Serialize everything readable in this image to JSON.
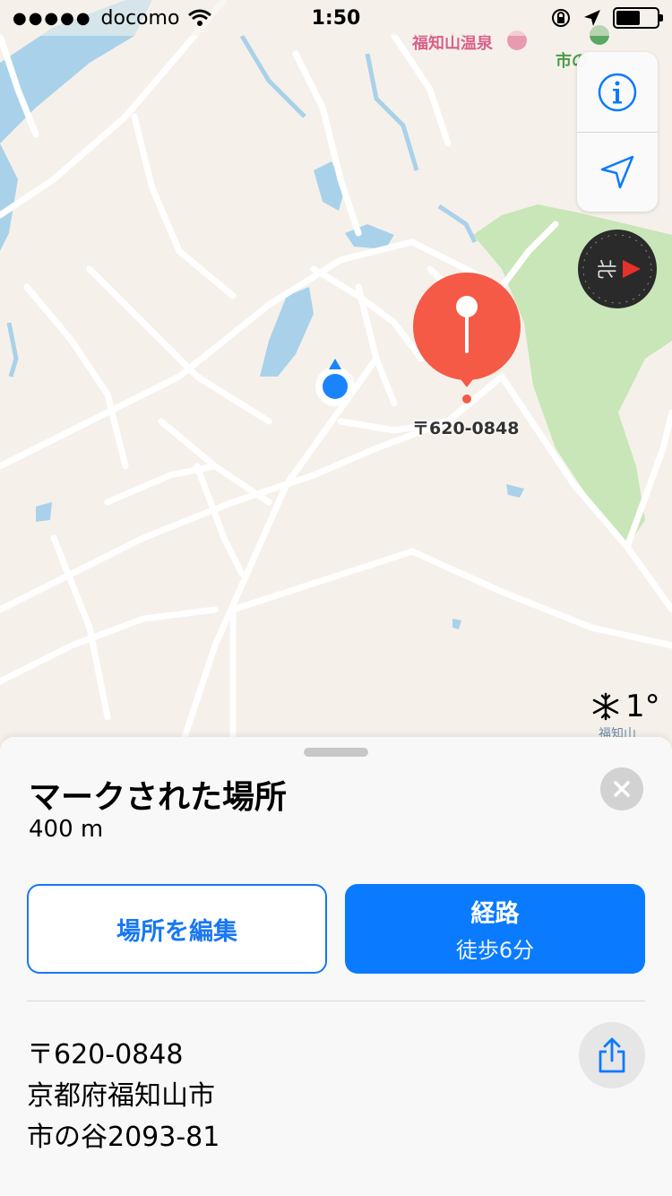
{
  "status_bar": {
    "carrier": "docomo",
    "time": "1:50",
    "battery_level": 0.6
  },
  "map": {
    "labels": {
      "onsen": "福知山温泉",
      "station": "市の",
      "bottom_right": "福知山",
      "pin_address": "〒620-0848"
    },
    "compass_label": "北",
    "weather": {
      "icon": "snowflake-icon",
      "temperature": "1°"
    },
    "controls": {
      "info_icon": "info-icon",
      "location_icon": "location-arrow-icon"
    }
  },
  "card": {
    "title": "マークされた場所",
    "distance": "400 m",
    "edit_button": "場所を編集",
    "route_button": {
      "label": "経路",
      "sub": "徒歩6分"
    },
    "address_lines": [
      "〒620-0848",
      "京都府福知山市",
      "市の谷2093-81"
    ]
  },
  "colors": {
    "accent": "#0a7aff",
    "pin": "#f55a47",
    "park": "#c8e6b8",
    "water": "#a9d2ea",
    "map_bg": "#f5f1ea"
  }
}
